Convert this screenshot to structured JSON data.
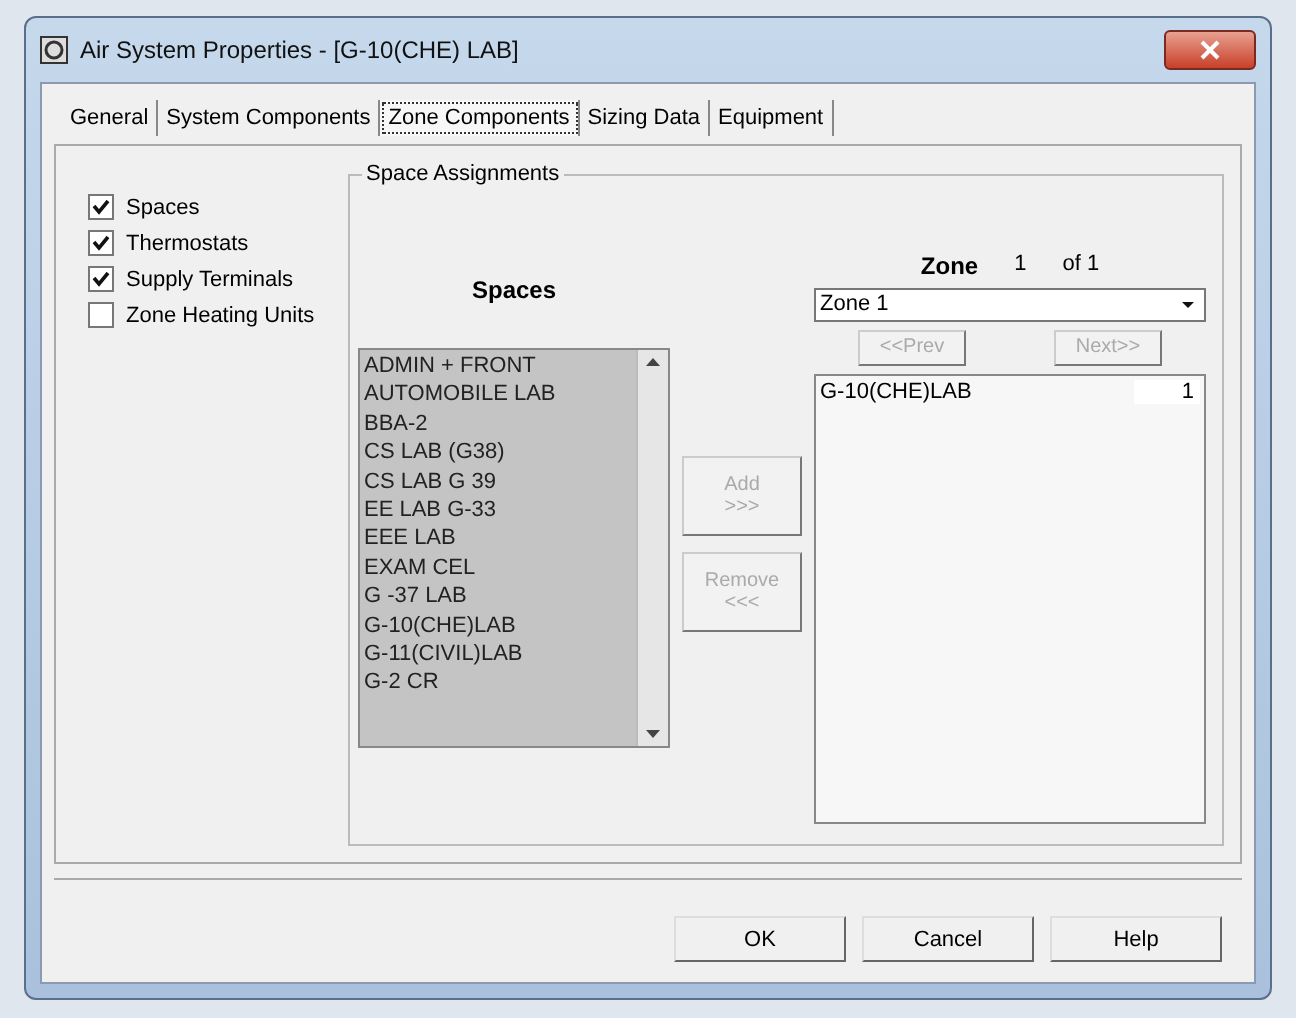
{
  "window": {
    "title": "Air System Properties - [G-10(CHE) LAB]"
  },
  "tabs": [
    {
      "label": "General",
      "selected": false
    },
    {
      "label": "System Components",
      "selected": false
    },
    {
      "label": "Zone Components",
      "selected": true
    },
    {
      "label": "Sizing Data",
      "selected": false
    },
    {
      "label": "Equipment",
      "selected": false
    }
  ],
  "components": [
    {
      "label": "Spaces",
      "checked": true
    },
    {
      "label": "Thermostats",
      "checked": true
    },
    {
      "label": "Supply Terminals",
      "checked": true
    },
    {
      "label": "Zone Heating Units",
      "checked": false
    }
  ],
  "space_assignments": {
    "title": "Space Assignments",
    "spaces_label": "Spaces",
    "spaces": [
      "ADMIN + FRONT",
      "AUTOMOBILE LAB",
      "BBA-2",
      "CS LAB (G38)",
      "CS LAB G 39",
      "EE LAB G-33",
      "EEE LAB",
      "EXAM CEL",
      "G -37 LAB",
      "G-10(CHE)LAB",
      "G-11(CIVIL)LAB",
      "G-2 CR"
    ],
    "move_buttons": [
      {
        "label": "Add",
        "arrows": ">>>",
        "disabled": true
      },
      {
        "label": "Remove",
        "arrows": "<<<",
        "disabled": true
      }
    ],
    "zone_label": "Zone",
    "zone_number": "1",
    "zone_of": "of 1",
    "zone_select": "Zone 1",
    "nav_buttons": [
      {
        "label": "<<Prev",
        "disabled": true
      },
      {
        "label": "Next>>",
        "disabled": true
      }
    ],
    "zone_spaces": [
      {
        "name": "G-10(CHE)LAB",
        "count": "1"
      }
    ]
  },
  "buttons": [
    "OK",
    "Cancel",
    "Help"
  ]
}
